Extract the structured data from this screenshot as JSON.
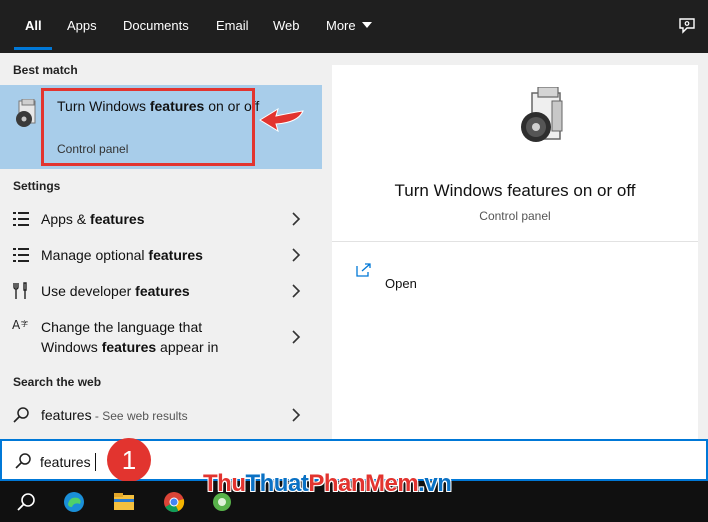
{
  "tabs": [
    {
      "label": "All",
      "active": true
    },
    {
      "label": "Apps"
    },
    {
      "label": "Documents"
    },
    {
      "label": "Email"
    },
    {
      "label": "Web"
    },
    {
      "label": "More"
    }
  ],
  "sections": {
    "best_match": "Best match",
    "settings": "Settings",
    "search_web": "Search the web"
  },
  "best_match": {
    "title_pre": "Turn Windows ",
    "title_bold": "features",
    "title_post": " on or off",
    "subtitle": "Control panel"
  },
  "settings_items": [
    {
      "pre": "Apps & ",
      "bold": "features",
      "post": ""
    },
    {
      "pre": "Manage optional ",
      "bold": "features",
      "post": ""
    },
    {
      "pre": "Use developer ",
      "bold": "features",
      "post": ""
    },
    {
      "line1": "Change the language that",
      "pre": "Windows ",
      "bold": "features",
      "post": " appear in"
    }
  ],
  "web_item": {
    "query": "features",
    "hint": " - See web results"
  },
  "detail": {
    "title": "Turn Windows features on or off",
    "subtitle": "Control panel",
    "open_label": "Open"
  },
  "search": {
    "value": "features"
  },
  "step_badge": "1",
  "watermark": {
    "part1": "Thu",
    "part2": "Thuat",
    "part3": "PhanMem",
    "part4": ".vn"
  },
  "colors": {
    "accent": "#0078d7",
    "selection": "#a8cdea",
    "annotation": "#e2342f"
  }
}
